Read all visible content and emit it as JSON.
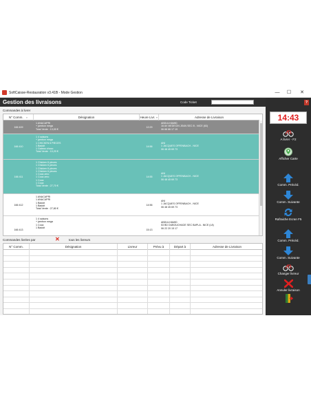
{
  "window": {
    "title": "SoftCaisse-Restauration v3.41B - Mode Gestion",
    "controls": [
      "—",
      "☐",
      "✕"
    ]
  },
  "header": {
    "title": "Gestion des livraisons",
    "ticket_label": "Code Ticket",
    "ticket_value": ""
  },
  "orders": {
    "section_label": "Commandes à livrer",
    "columns": [
      "N° Comm.",
      "Désignation",
      "Heure Livr.",
      "Adresse de Livraison"
    ],
    "rows": [
      {
        "num": "166 409",
        "designation": [
          "1  ANACAPRI",
          "    + jambon  mega",
          "Total Vente : 13,00 €"
        ],
        "time": "12:29",
        "address": [
          "ABDULHAMID",
          "16 AV MEDECIN JEAN SEC B - NICE (83)",
          "06 88 86 17 19"
        ],
        "style": "gray"
      },
      {
        "num": "166 410",
        "designation": [
          "1  4 saisons",
          "    + jambon  mega",
          "1  CHICKEN 6 PIECES",
          "1  Badoit",
          "1  Gateau choco",
          "Total Vente : 10,20 €"
        ],
        "time": "14:56",
        "address": [
          "ANI",
          "1 JACQUES OFFENBACH - NICE",
          "06 48 45 69 73"
        ],
        "style": "teal"
      },
      {
        "num": "166 411",
        "designation": [
          "1  Chicken 6 pieces",
          "1  Chicken 6 pieces",
          "1  Chicken 6 pieces",
          "1  Chicken 6 pieces",
          "1  Coca zero",
          "1  Coca zero",
          "1  Coca",
          "1  Coca",
          "Total Vente : 27,70 €"
        ],
        "time": "14:55",
        "address": [
          "ANI",
          "1 JACQUES OFFENBACH - NICE",
          "06 48 45 69 73"
        ],
        "style": "teal"
      },
      {
        "num": "166 412",
        "designation": [
          "1  ANACAPRI",
          "1  ANACAPRI",
          "1  Badoit",
          "1  Badoit",
          "Total Vente : 27,80 €"
        ],
        "time": "14:56",
        "address": [
          "ANI",
          "1 JACQUES OFFENBACH - NICE",
          "06 48 45 69 73"
        ],
        "style": "white"
      },
      {
        "num": "166 413",
        "designation": [
          "1  4 saisons",
          "    + jambon  mega",
          "1  Coca",
          "1  Badoit"
        ],
        "time": "15:13",
        "address": [
          "ABDULHAMID",
          "53 BD DUBOUCHAGE SEC BAPLA - NICE (L8)",
          "06 22 20 15 17"
        ],
        "style": "white"
      }
    ]
  },
  "delivered": {
    "section_label": "Commandes livrées par",
    "filter_label": "tous les livreurs",
    "columns": [
      "N° Comm.",
      "Désignation",
      "Livreur",
      "Prévu à",
      "Départ à",
      "Adresse de Livraison"
    ]
  },
  "sidebar": {
    "clock": "14:43",
    "help": "?",
    "buttons": [
      {
        "label": "A livrer - F2",
        "icon": "bicycle-icon"
      },
      {
        "label": "Afficher Carte",
        "icon": "map-icon"
      },
      {
        "label": "Comm. Précéd.",
        "icon": "arrow-up-icon"
      },
      {
        "label": "Comm. Suivante",
        "icon": "arrow-down-icon"
      },
      {
        "label": "Rafraiche Ecran F5",
        "icon": "refresh-icon"
      },
      {
        "label": "Comm. Précéd.",
        "icon": "arrow-up-icon"
      },
      {
        "label": "Comm. Suivante",
        "icon": "arrow-down-icon"
      },
      {
        "label": "Changer livreur",
        "icon": "bicycle-icon"
      },
      {
        "label": "Annuler livraison",
        "icon": "cancel-x-icon"
      },
      {
        "label": "",
        "icon": "exit-door-icon"
      }
    ]
  },
  "colors": {
    "header_bg": "#2f2f2f",
    "selected_row": "#8c8c8c",
    "highlight_row": "#69c1b8",
    "clock_red": "#e02020",
    "button_blue": "#2e86d6"
  }
}
